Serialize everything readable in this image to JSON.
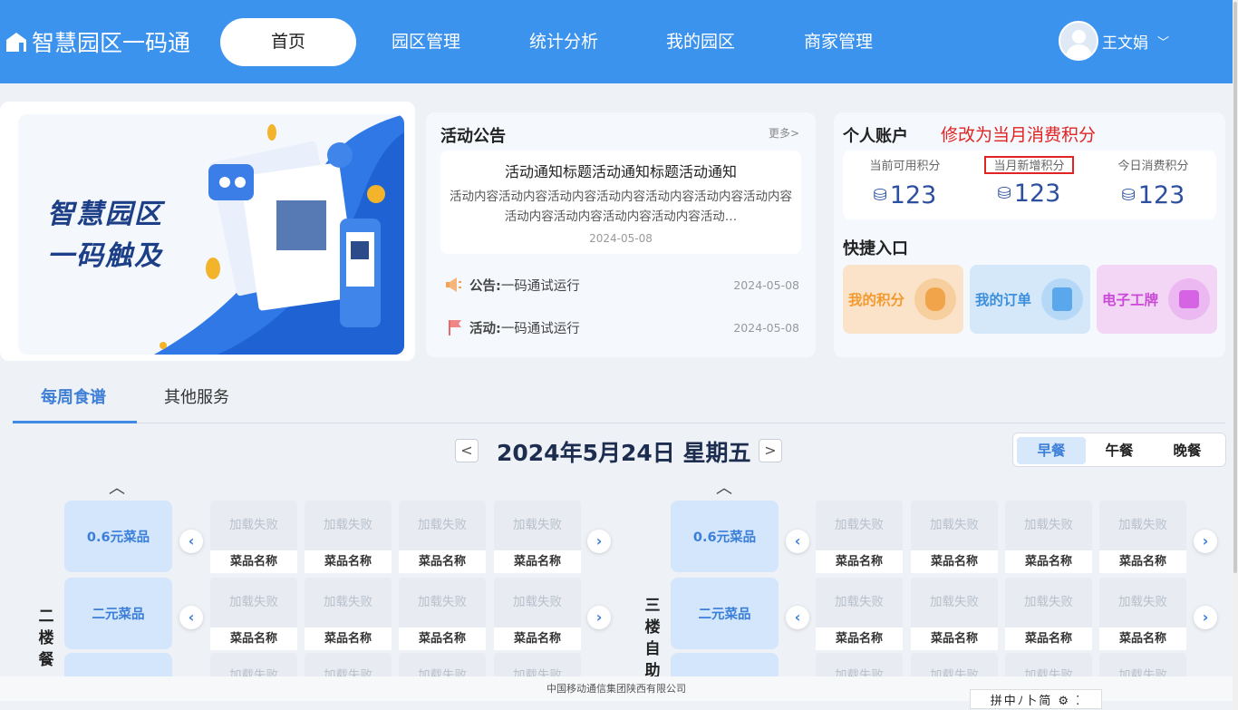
{
  "app": {
    "title": "智慧园区一码通"
  },
  "nav": {
    "items": [
      {
        "label": "首页",
        "active": true
      },
      {
        "label": "园区管理"
      },
      {
        "label": "统计分析"
      },
      {
        "label": "我的园区"
      },
      {
        "label": "商家管理"
      }
    ]
  },
  "user": {
    "name": "王文娟"
  },
  "banner": {
    "line1": "智慧园区",
    "line2": "一码触及"
  },
  "notice": {
    "title": "活动公告",
    "more": "更多>",
    "featured": {
      "title": "活动通知标题活动通知标题活动通知",
      "content": "活动内容活动内容活动内容活动内容活动内容活动内容活动内容活动内容活动内容活动内容活动内容活动…",
      "date": "2024-05-08"
    },
    "rows": [
      {
        "label": "公告:",
        "text": "一码通试运行",
        "date": "2024-05-08"
      },
      {
        "label": "活动:",
        "text": "一码通试运行",
        "date": "2024-05-08"
      }
    ]
  },
  "account": {
    "title": "个人账户",
    "note": "修改为当月消费积分",
    "points": [
      {
        "label": "当前可用积分",
        "value": "123"
      },
      {
        "label": "当月新增积分",
        "value": "123"
      },
      {
        "label": "今日消费积分",
        "value": "123"
      }
    ],
    "quick_title": "快捷入口",
    "quick": [
      {
        "label": "我的积分",
        "color": "#f39a2e"
      },
      {
        "label": "我的订单",
        "color": "#3b8fdc"
      },
      {
        "label": "电子工牌",
        "color": "#c94ad6"
      }
    ]
  },
  "tabs": [
    {
      "label": "每周食谱",
      "active": true
    },
    {
      "label": "其他服务"
    }
  ],
  "date_bar": {
    "title": "2024年5月24日 星期五",
    "prev": "<",
    "next": ">"
  },
  "meals": [
    {
      "label": "早餐",
      "active": true
    },
    {
      "label": "午餐"
    },
    {
      "label": "晚餐"
    }
  ],
  "food": {
    "load_failed": "加载失败",
    "dish_name": "菜品名称",
    "categories": [
      "0.6元菜品",
      "二元菜品"
    ],
    "left_floor": "二楼餐",
    "right_floor": "三楼自助"
  },
  "footer": {
    "text": "中国移动通信集团陕西有限公司"
  },
  "ime": {
    "text": "拼中ﾉ卜简 ⚙ ⁚"
  }
}
